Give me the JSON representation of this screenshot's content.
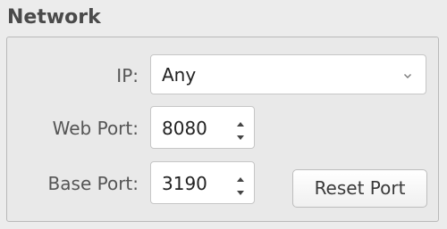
{
  "section": {
    "title": "Network"
  },
  "ip": {
    "label": "IP:",
    "selected": "Any",
    "arrow_icon": "chevron-down-icon"
  },
  "web_port": {
    "label": "Web Port:",
    "value": "8080"
  },
  "base_port": {
    "label": "Base Port:",
    "value": "3190"
  },
  "actions": {
    "reset_port": "Reset Port"
  }
}
